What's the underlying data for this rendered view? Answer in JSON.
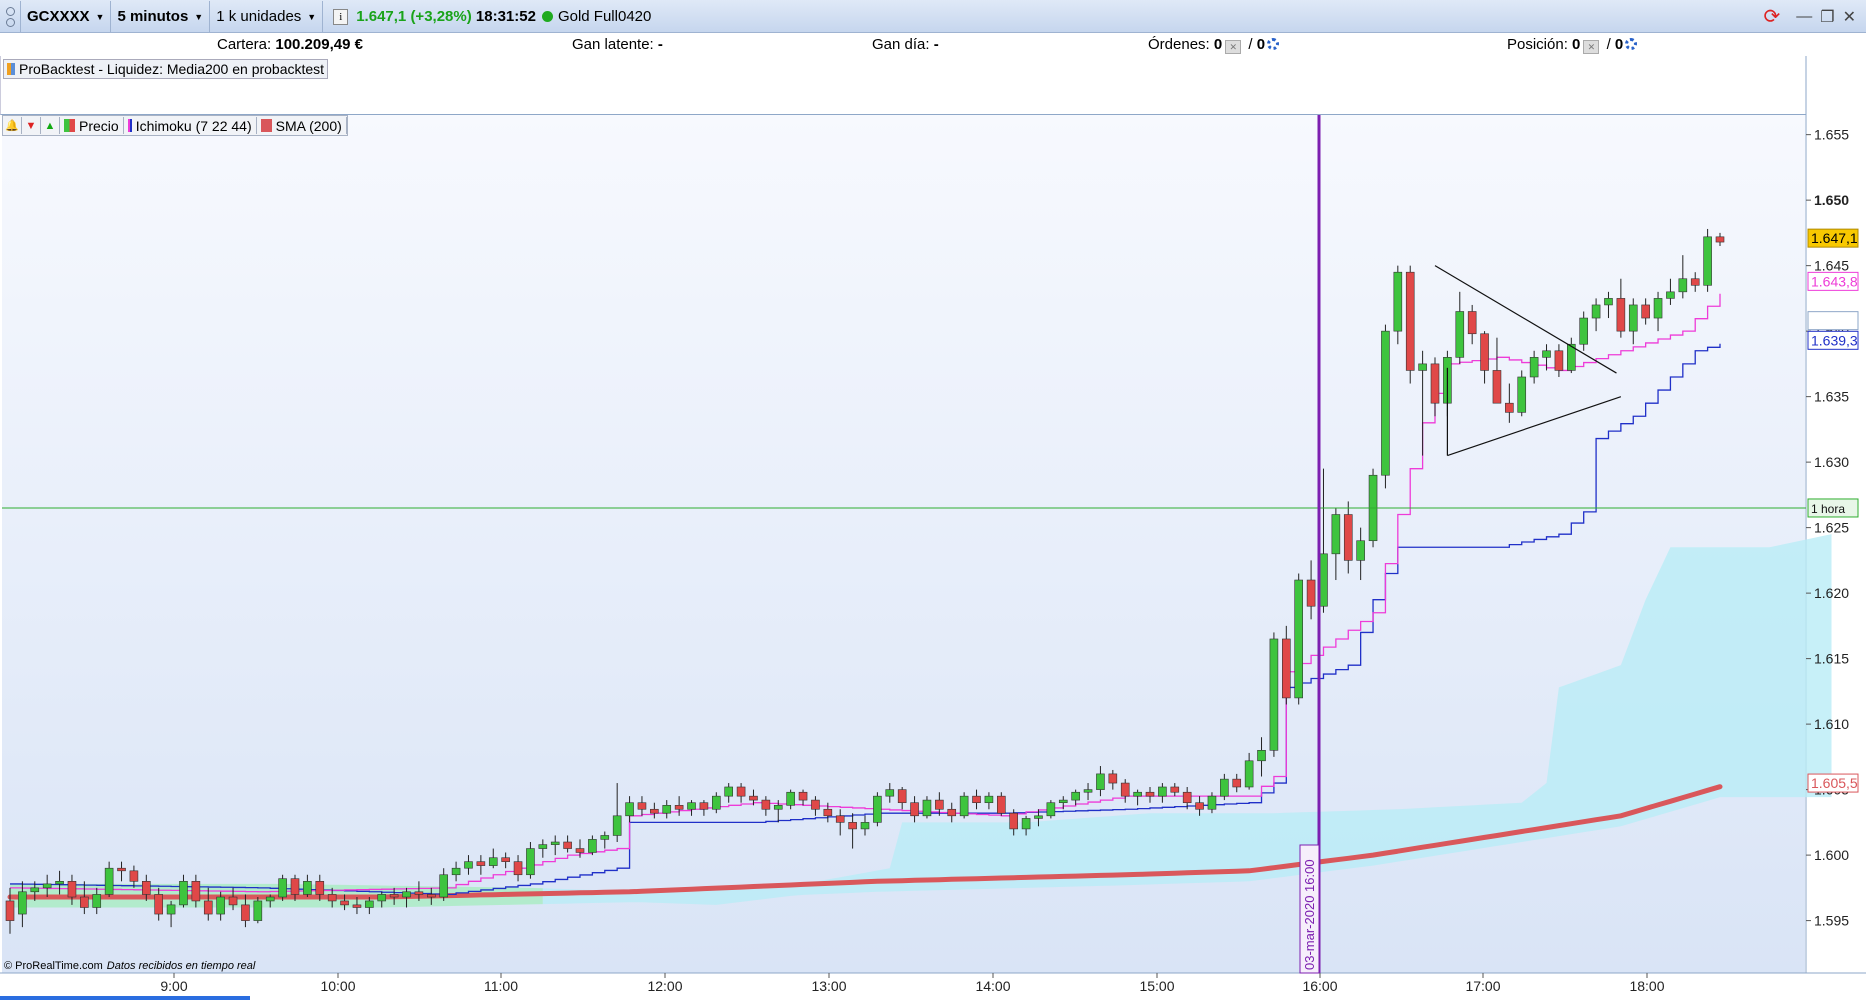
{
  "toolbar": {
    "instrument": "GCXXXX",
    "timeframe": "5 minutos",
    "units": "1 k unidades",
    "info_icon": "info-icon",
    "last_price": "1.647,1",
    "change": "(+3,28%)",
    "time": "18:31:52",
    "status_icon": "green-dot-icon",
    "product": "Gold Full0420"
  },
  "account": {
    "cartera_label": "Cartera:",
    "cartera_value": "100.209,49 €",
    "gan_latente_label": "Gan latente:",
    "gan_latente_value": "-",
    "gan_dia_label": "Gan día:",
    "gan_dia_value": "-",
    "ordenes_label": "Órdenes:",
    "ordenes_value": "0",
    "ordenes_value2": "0",
    "posicion_label": "Posición:",
    "posicion_value": "0",
    "posicion_value2": "0",
    "slash": "/"
  },
  "probacktest_label": "ProBacktest - Liquidez: Media200 en probacktest",
  "legend": {
    "price": "Precio",
    "ichimoku": "Ichimoku (7 22 44)",
    "sma": "SMA (200)"
  },
  "footer": {
    "copyright": "© ProRealTime.com",
    "realtime": "Datos recibidos en tiempo real"
  },
  "colors": {
    "up": "#3ec43e",
    "down": "#e04848",
    "tenkan": "#ee3bd8",
    "kijun": "#2030c8",
    "sma": "#d9575b",
    "cloud_bull": "#a7ecc0",
    "cloud_bear": "#b9ecf6",
    "vline": "#7c1fb0",
    "hline": "#2fae2f"
  },
  "chart_data": {
    "type": "candlestick",
    "title": "",
    "xlabel": "",
    "ylabel": "",
    "ylim": [
      1.591,
      1.6565
    ],
    "y_ticks": [
      "1.655",
      "1.650",
      "1.645",
      "1.640",
      "1.635",
      "1.630",
      "1.625",
      "1.620",
      "1.615",
      "1.610",
      "1.605",
      "1.600",
      "1.595"
    ],
    "x_ticks": [
      "9:00",
      "10:00",
      "11:00",
      "12:00",
      "13:00",
      "14:00",
      "15:00",
      "16:00",
      "17:00",
      "18:00"
    ],
    "vertical_line_label": "03-mar-2020 16:00",
    "horizontal_line_label": "1 hora",
    "horizontal_line_price": 1.6265,
    "price_tags": [
      {
        "text": "1.647,1",
        "value": 1.6471,
        "style": "last"
      },
      {
        "text": "1.643,8",
        "value": 1.6438,
        "style": "tenkan"
      },
      {
        "text": "1.639,3",
        "value": 1.6393,
        "style": "kijun"
      },
      {
        "text": "1.605,5",
        "value": 1.6055,
        "style": "sma"
      }
    ],
    "ohlc_points": [
      [
        1.5965,
        1.5975,
        1.594,
        1.595
      ],
      [
        1.5955,
        1.598,
        1.5945,
        1.5972
      ],
      [
        1.5972,
        1.598,
        1.5965,
        1.5975
      ],
      [
        1.5975,
        1.5985,
        1.5968,
        1.5978
      ],
      [
        1.5978,
        1.5988,
        1.597,
        1.598
      ],
      [
        1.598,
        1.5985,
        1.5962,
        1.5968
      ],
      [
        1.5968,
        1.598,
        1.5955,
        1.596
      ],
      [
        1.596,
        1.5975,
        1.5955,
        1.597
      ],
      [
        1.597,
        1.5995,
        1.5968,
        1.599
      ],
      [
        1.599,
        1.5995,
        1.598,
        1.5988
      ],
      [
        1.5988,
        1.5992,
        1.5975,
        1.598
      ],
      [
        1.598,
        1.5985,
        1.5965,
        1.597
      ],
      [
        1.597,
        1.5975,
        1.595,
        1.5955
      ],
      [
        1.5955,
        1.5965,
        1.5945,
        1.5962
      ],
      [
        1.5962,
        1.5985,
        1.596,
        1.598
      ],
      [
        1.598,
        1.5985,
        1.596,
        1.5965
      ],
      [
        1.5965,
        1.5975,
        1.595,
        1.5955
      ],
      [
        1.5955,
        1.5972,
        1.595,
        1.5968
      ],
      [
        1.5968,
        1.5975,
        1.5958,
        1.5962
      ],
      [
        1.5962,
        1.597,
        1.5945,
        1.595
      ],
      [
        1.595,
        1.5968,
        1.5948,
        1.5965
      ],
      [
        1.5965,
        1.597,
        1.596,
        1.5968
      ],
      [
        1.5968,
        1.5985,
        1.5965,
        1.5982
      ],
      [
        1.5982,
        1.5985,
        1.5965,
        1.597
      ],
      [
        1.597,
        1.5985,
        1.5968,
        1.598
      ],
      [
        1.598,
        1.5985,
        1.5965,
        1.597
      ],
      [
        1.597,
        1.5975,
        1.596,
        1.5965
      ],
      [
        1.5965,
        1.597,
        1.5958,
        1.5962
      ],
      [
        1.5962,
        1.5968,
        1.5955,
        1.596
      ],
      [
        1.596,
        1.5968,
        1.5955,
        1.5965
      ],
      [
        1.5965,
        1.5972,
        1.596,
        1.597
      ],
      [
        1.597,
        1.5975,
        1.5962,
        1.5968
      ],
      [
        1.5968,
        1.5975,
        1.596,
        1.5972
      ],
      [
        1.5972,
        1.598,
        1.5965,
        1.597
      ],
      [
        1.597,
        1.5975,
        1.5962,
        1.5968
      ],
      [
        1.5968,
        1.599,
        1.5965,
        1.5985
      ],
      [
        1.5985,
        1.5995,
        1.598,
        1.599
      ],
      [
        1.599,
        1.6,
        1.5985,
        1.5995
      ],
      [
        1.5995,
        1.6,
        1.5985,
        1.5992
      ],
      [
        1.5992,
        1.6005,
        1.599,
        1.5998
      ],
      [
        1.5998,
        1.6002,
        1.599,
        1.5995
      ],
      [
        1.5995,
        1.6,
        1.598,
        1.5985
      ],
      [
        1.5985,
        1.601,
        1.5982,
        1.6005
      ],
      [
        1.6005,
        1.6012,
        1.5998,
        1.6008
      ],
      [
        1.6008,
        1.6015,
        1.6,
        1.601
      ],
      [
        1.601,
        1.6015,
        1.6002,
        1.6005
      ],
      [
        1.6005,
        1.6012,
        1.5998,
        1.6002
      ],
      [
        1.6002,
        1.6015,
        1.6,
        1.6012
      ],
      [
        1.6012,
        1.6018,
        1.6005,
        1.6015
      ],
      [
        1.6015,
        1.6055,
        1.601,
        1.603
      ],
      [
        1.603,
        1.6045,
        1.6025,
        1.604
      ],
      [
        1.604,
        1.6045,
        1.603,
        1.6035
      ],
      [
        1.6035,
        1.604,
        1.6028,
        1.6032
      ],
      [
        1.6032,
        1.6042,
        1.6028,
        1.6038
      ],
      [
        1.6038,
        1.6045,
        1.603,
        1.6035
      ],
      [
        1.6035,
        1.6042,
        1.603,
        1.604
      ],
      [
        1.604,
        1.6042,
        1.603,
        1.6035
      ],
      [
        1.6035,
        1.6048,
        1.6032,
        1.6045
      ],
      [
        1.6045,
        1.6055,
        1.604,
        1.6052
      ],
      [
        1.6052,
        1.6055,
        1.604,
        1.6045
      ],
      [
        1.6045,
        1.605,
        1.6038,
        1.6042
      ],
      [
        1.6042,
        1.6045,
        1.603,
        1.6035
      ],
      [
        1.6035,
        1.6042,
        1.6025,
        1.6038
      ],
      [
        1.6038,
        1.605,
        1.6035,
        1.6048
      ],
      [
        1.6048,
        1.605,
        1.6038,
        1.6042
      ],
      [
        1.6042,
        1.6045,
        1.603,
        1.6035
      ],
      [
        1.6035,
        1.604,
        1.6025,
        1.603
      ],
      [
        1.603,
        1.6035,
        1.6015,
        1.6025
      ],
      [
        1.6025,
        1.6032,
        1.6005,
        1.602
      ],
      [
        1.602,
        1.603,
        1.6015,
        1.6025
      ],
      [
        1.6025,
        1.6048,
        1.6022,
        1.6045
      ],
      [
        1.6045,
        1.6055,
        1.604,
        1.605
      ],
      [
        1.605,
        1.6052,
        1.6035,
        1.604
      ],
      [
        1.604,
        1.6045,
        1.6025,
        1.603
      ],
      [
        1.603,
        1.6045,
        1.6028,
        1.6042
      ],
      [
        1.6042,
        1.6048,
        1.603,
        1.6035
      ],
      [
        1.6035,
        1.604,
        1.6025,
        1.603
      ],
      [
        1.603,
        1.6048,
        1.6028,
        1.6045
      ],
      [
        1.6045,
        1.605,
        1.6035,
        1.604
      ],
      [
        1.604,
        1.6048,
        1.6035,
        1.6045
      ],
      [
        1.6045,
        1.6048,
        1.603,
        1.6032
      ],
      [
        1.6032,
        1.6035,
        1.6015,
        1.602
      ],
      [
        1.602,
        1.603,
        1.6015,
        1.6028
      ],
      [
        1.6028,
        1.6035,
        1.6022,
        1.603
      ],
      [
        1.603,
        1.6042,
        1.6028,
        1.604
      ],
      [
        1.604,
        1.6045,
        1.6035,
        1.6042
      ],
      [
        1.6042,
        1.605,
        1.6038,
        1.6048
      ],
      [
        1.6048,
        1.6055,
        1.6042,
        1.605
      ],
      [
        1.605,
        1.6068,
        1.6045,
        1.6062
      ],
      [
        1.6062,
        1.6065,
        1.605,
        1.6055
      ],
      [
        1.6055,
        1.6058,
        1.604,
        1.6045
      ],
      [
        1.6045,
        1.605,
        1.6038,
        1.6048
      ],
      [
        1.6048,
        1.6052,
        1.604,
        1.6045
      ],
      [
        1.6045,
        1.6055,
        1.604,
        1.6052
      ],
      [
        1.6052,
        1.6055,
        1.6045,
        1.6048
      ],
      [
        1.6048,
        1.6052,
        1.6035,
        1.604
      ],
      [
        1.604,
        1.6045,
        1.603,
        1.6035
      ],
      [
        1.6035,
        1.6048,
        1.6032,
        1.6045
      ],
      [
        1.6045,
        1.6062,
        1.6042,
        1.6058
      ],
      [
        1.6058,
        1.6062,
        1.6048,
        1.6052
      ],
      [
        1.6052,
        1.6078,
        1.605,
        1.6072
      ],
      [
        1.6072,
        1.609,
        1.606,
        1.608
      ],
      [
        1.608,
        1.617,
        1.6075,
        1.6165
      ],
      [
        1.6165,
        1.6175,
        1.6115,
        1.612
      ],
      [
        1.612,
        1.6215,
        1.6115,
        1.621
      ],
      [
        1.621,
        1.6225,
        1.618,
        1.619
      ],
      [
        1.619,
        1.6295,
        1.6185,
        1.623
      ],
      [
        1.623,
        1.6265,
        1.621,
        1.626
      ],
      [
        1.626,
        1.627,
        1.6215,
        1.6225
      ],
      [
        1.6225,
        1.625,
        1.621,
        1.624
      ],
      [
        1.624,
        1.6295,
        1.6235,
        1.629
      ],
      [
        1.629,
        1.6405,
        1.628,
        1.64
      ],
      [
        1.64,
        1.645,
        1.639,
        1.6445
      ],
      [
        1.6445,
        1.645,
        1.636,
        1.637
      ],
      [
        1.637,
        1.6385,
        1.6305,
        1.6375
      ],
      [
        1.6375,
        1.638,
        1.6335,
        1.6345
      ],
      [
        1.6345,
        1.6385,
        1.6335,
        1.638
      ],
      [
        1.638,
        1.643,
        1.6375,
        1.6415
      ],
      [
        1.6415,
        1.642,
        1.639,
        1.6398
      ],
      [
        1.6398,
        1.64,
        1.636,
        1.637
      ],
      [
        1.637,
        1.6395,
        1.635,
        1.6345
      ],
      [
        1.6345,
        1.636,
        1.633,
        1.6338
      ],
      [
        1.6338,
        1.637,
        1.6335,
        1.6365
      ],
      [
        1.6365,
        1.6385,
        1.636,
        1.638
      ],
      [
        1.638,
        1.639,
        1.637,
        1.6385
      ],
      [
        1.6385,
        1.639,
        1.6365,
        1.637
      ],
      [
        1.637,
        1.6395,
        1.6368,
        1.639
      ],
      [
        1.639,
        1.6415,
        1.6385,
        1.641
      ],
      [
        1.641,
        1.6425,
        1.64,
        1.642
      ],
      [
        1.642,
        1.643,
        1.641,
        1.6425
      ],
      [
        1.6425,
        1.644,
        1.6395,
        1.64
      ],
      [
        1.64,
        1.6425,
        1.639,
        1.642
      ],
      [
        1.642,
        1.6425,
        1.6405,
        1.641
      ],
      [
        1.641,
        1.643,
        1.64,
        1.6425
      ],
      [
        1.6425,
        1.644,
        1.642,
        1.643
      ],
      [
        1.643,
        1.6458,
        1.6425,
        1.644
      ],
      [
        1.644,
        1.6445,
        1.643,
        1.6435
      ],
      [
        1.6435,
        1.6478,
        1.643,
        1.6472
      ],
      [
        1.6472,
        1.6475,
        1.6465,
        1.6468
      ]
    ],
    "sma_points": [
      [
        0,
        1.5968
      ],
      [
        30,
        1.5968
      ],
      [
        50,
        1.5972
      ],
      [
        70,
        1.598
      ],
      [
        90,
        1.5985
      ],
      [
        100,
        1.5988
      ],
      [
        110,
        1.6
      ],
      [
        120,
        1.6015
      ],
      [
        130,
        1.603
      ],
      [
        139,
        1.6055
      ]
    ],
    "tenkan_points": [
      [
        0,
        1.5975
      ],
      [
        20,
        1.5972
      ],
      [
        35,
        1.5975
      ],
      [
        45,
        1.6
      ],
      [
        49,
        1.6005
      ],
      [
        50,
        1.603
      ],
      [
        60,
        1.604
      ],
      [
        70,
        1.6035
      ],
      [
        80,
        1.603
      ],
      [
        90,
        1.6045
      ],
      [
        100,
        1.6045
      ],
      [
        102,
        1.606
      ],
      [
        103,
        1.614
      ],
      [
        107,
        1.6165
      ],
      [
        110,
        1.6185
      ],
      [
        112,
        1.626
      ],
      [
        114,
        1.633
      ],
      [
        116,
        1.6375
      ],
      [
        120,
        1.638
      ],
      [
        125,
        1.637
      ],
      [
        130,
        1.6385
      ],
      [
        135,
        1.64
      ],
      [
        139,
        1.6438
      ]
    ],
    "kijun_points": [
      [
        0,
        1.5978
      ],
      [
        20,
        1.5975
      ],
      [
        35,
        1.597
      ],
      [
        42,
        1.5978
      ],
      [
        49,
        1.599
      ],
      [
        50,
        1.6025
      ],
      [
        60,
        1.6025
      ],
      [
        70,
        1.6032
      ],
      [
        80,
        1.6032
      ],
      [
        90,
        1.6035
      ],
      [
        100,
        1.604
      ],
      [
        102,
        1.6055
      ],
      [
        103,
        1.6128
      ],
      [
        108,
        1.6145
      ],
      [
        110,
        1.6195
      ],
      [
        112,
        1.6235
      ],
      [
        120,
        1.6235
      ],
      [
        125,
        1.6245
      ],
      [
        127,
        1.6262
      ],
      [
        128,
        1.6318
      ],
      [
        131,
        1.6335
      ],
      [
        133,
        1.6355
      ],
      [
        136,
        1.6385
      ],
      [
        139,
        1.6393
      ]
    ],
    "triangle_points": [
      [
        1.645,
        1.6305
      ],
      [
        1.6385,
        1.635
      ]
    ]
  }
}
